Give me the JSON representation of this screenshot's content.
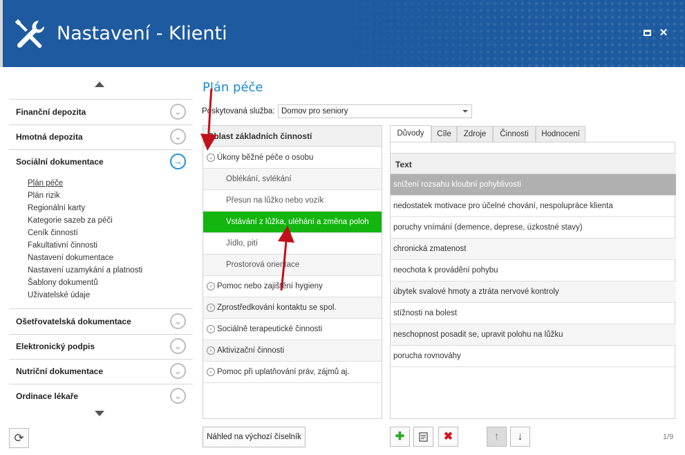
{
  "window": {
    "title": "Nastavení - Klienti",
    "maximize_icon": "maximize-icon",
    "close_label": "✕"
  },
  "sidebar": {
    "sections_top": [
      {
        "label": "Finanční depozita"
      },
      {
        "label": "Hmotná depozita"
      },
      {
        "label": "Sociální dokumentace",
        "active": true
      }
    ],
    "subitems": [
      {
        "label": "Plán péče",
        "active": true
      },
      {
        "label": "Plán rizik"
      },
      {
        "label": "Regionální karty"
      },
      {
        "label": "Kategorie sazeb za péči"
      },
      {
        "label": "Ceník činností"
      },
      {
        "label": "Fakultativní činnosti"
      },
      {
        "label": "Nastavení dokumentace"
      },
      {
        "label": "Nastavení uzamykání a platnosti"
      },
      {
        "label": "Šablony dokumentů"
      },
      {
        "label": "Uživatelské údaje"
      }
    ],
    "sections_bottom": [
      {
        "label": "Ošetřovatelská dokumentace"
      },
      {
        "label": "Elektronický podpis"
      },
      {
        "label": "Nutriční dokumentace"
      },
      {
        "label": "Ordinace lékaře"
      }
    ]
  },
  "main": {
    "title": "Plán péče",
    "service_label": "Poskytovaná služba:",
    "service_value": "Domov pro seniory"
  },
  "activities": {
    "header": "Oblast základních činností",
    "rows": [
      {
        "label": "Úkony běžné péče o osobu",
        "kind": "group",
        "expanded": true
      },
      {
        "label": "Oblékání, svlékání",
        "kind": "sub"
      },
      {
        "label": "Přesun na lůžko nebo vozík",
        "kind": "sub"
      },
      {
        "label": "Vstávání z lůžka, uléhání a změna poloh",
        "kind": "sub",
        "selected": true
      },
      {
        "label": "Jídlo, pití",
        "kind": "sub"
      },
      {
        "label": "Prostorová orientace",
        "kind": "sub"
      },
      {
        "label": "Pomoc nebo zajištění hygieny",
        "kind": "group"
      },
      {
        "label": "Zprostředkování kontaktu se spol.",
        "kind": "group"
      },
      {
        "label": "Sociálně terapeutické činnosti",
        "kind": "group"
      },
      {
        "label": "Aktivizační činnosti",
        "kind": "group"
      },
      {
        "label": "Pomoc při uplatňování práv, zájmů aj.",
        "kind": "group"
      }
    ]
  },
  "preview_button": "Náhled na výchozí číselník",
  "tabs": [
    {
      "label": "Důvody",
      "active": true
    },
    {
      "label": "Cíle"
    },
    {
      "label": "Zdroje"
    },
    {
      "label": "Činnosti"
    },
    {
      "label": "Hodnocení"
    }
  ],
  "grid": {
    "header": "Text",
    "rows": [
      {
        "text": "snížení rozsahu kloubní pohyblivosti",
        "selected": true
      },
      {
        "text": "nedostatek motivace pro účelné chování, nespolupráce klienta"
      },
      {
        "text": "poruchy vnímání (demence, deprese, úzkostné stavy)"
      },
      {
        "text": "chronická zmatenost"
      },
      {
        "text": "neochota k provádění pohybu"
      },
      {
        "text": "úbytek svalové hmoty a ztráta nervové kontroly"
      },
      {
        "text": "stížnosti na bolest"
      },
      {
        "text": "neschopnost posadit se, upravit polohu na lůžku"
      },
      {
        "text": "porucha rovnováhy"
      }
    ]
  },
  "toolbar": {
    "add_icon": "plus-icon",
    "edit_icon": "document-icon",
    "delete_icon": "delete-icon",
    "up_icon": "arrow-up-icon",
    "down_icon": "arrow-down-icon",
    "pager": "1/9"
  },
  "colors": {
    "titlebar": "#1d5aa0",
    "accent": "#1a8bd1",
    "selected_row": "#12b60e",
    "annotation_arrow": "#c0101a"
  }
}
